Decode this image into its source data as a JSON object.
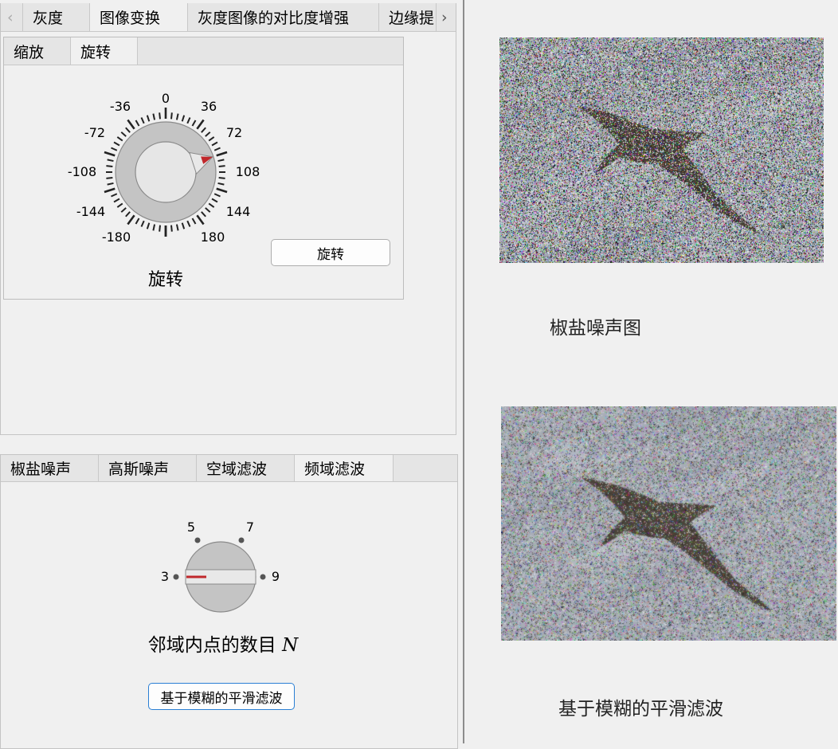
{
  "top_tabs": {
    "items": [
      "灰度",
      "图像变换",
      "灰度图像的对比度增强",
      "边缘提"
    ],
    "active_index": 1
  },
  "transform_tabs": {
    "items": [
      "缩放",
      "旋转"
    ],
    "active_index": 1
  },
  "rotate_knob": {
    "labels": [
      "0",
      "36",
      "72",
      "108",
      "144",
      "180",
      "-36",
      "-72",
      "-108",
      "-144",
      "-180"
    ],
    "value": 72,
    "title": "旋转"
  },
  "rotate_button": "旋转",
  "noise_tabs": {
    "items": [
      "椒盐噪声",
      "高斯噪声",
      "空域滤波",
      "频域滤波"
    ],
    "active_index": 3
  },
  "neighbor_knob": {
    "options": [
      "3",
      "5",
      "7",
      "9"
    ],
    "selected": "3",
    "title": "邻域内点的数目",
    "title_symbol": "N"
  },
  "filter_button": "基于模糊的平滑滤波",
  "images": [
    {
      "caption": "椒盐噪声图"
    },
    {
      "caption": "基于模糊的平滑滤波"
    }
  ],
  "colors": {
    "needle": "#c0282c",
    "accent_border": "#2a7fd4"
  }
}
